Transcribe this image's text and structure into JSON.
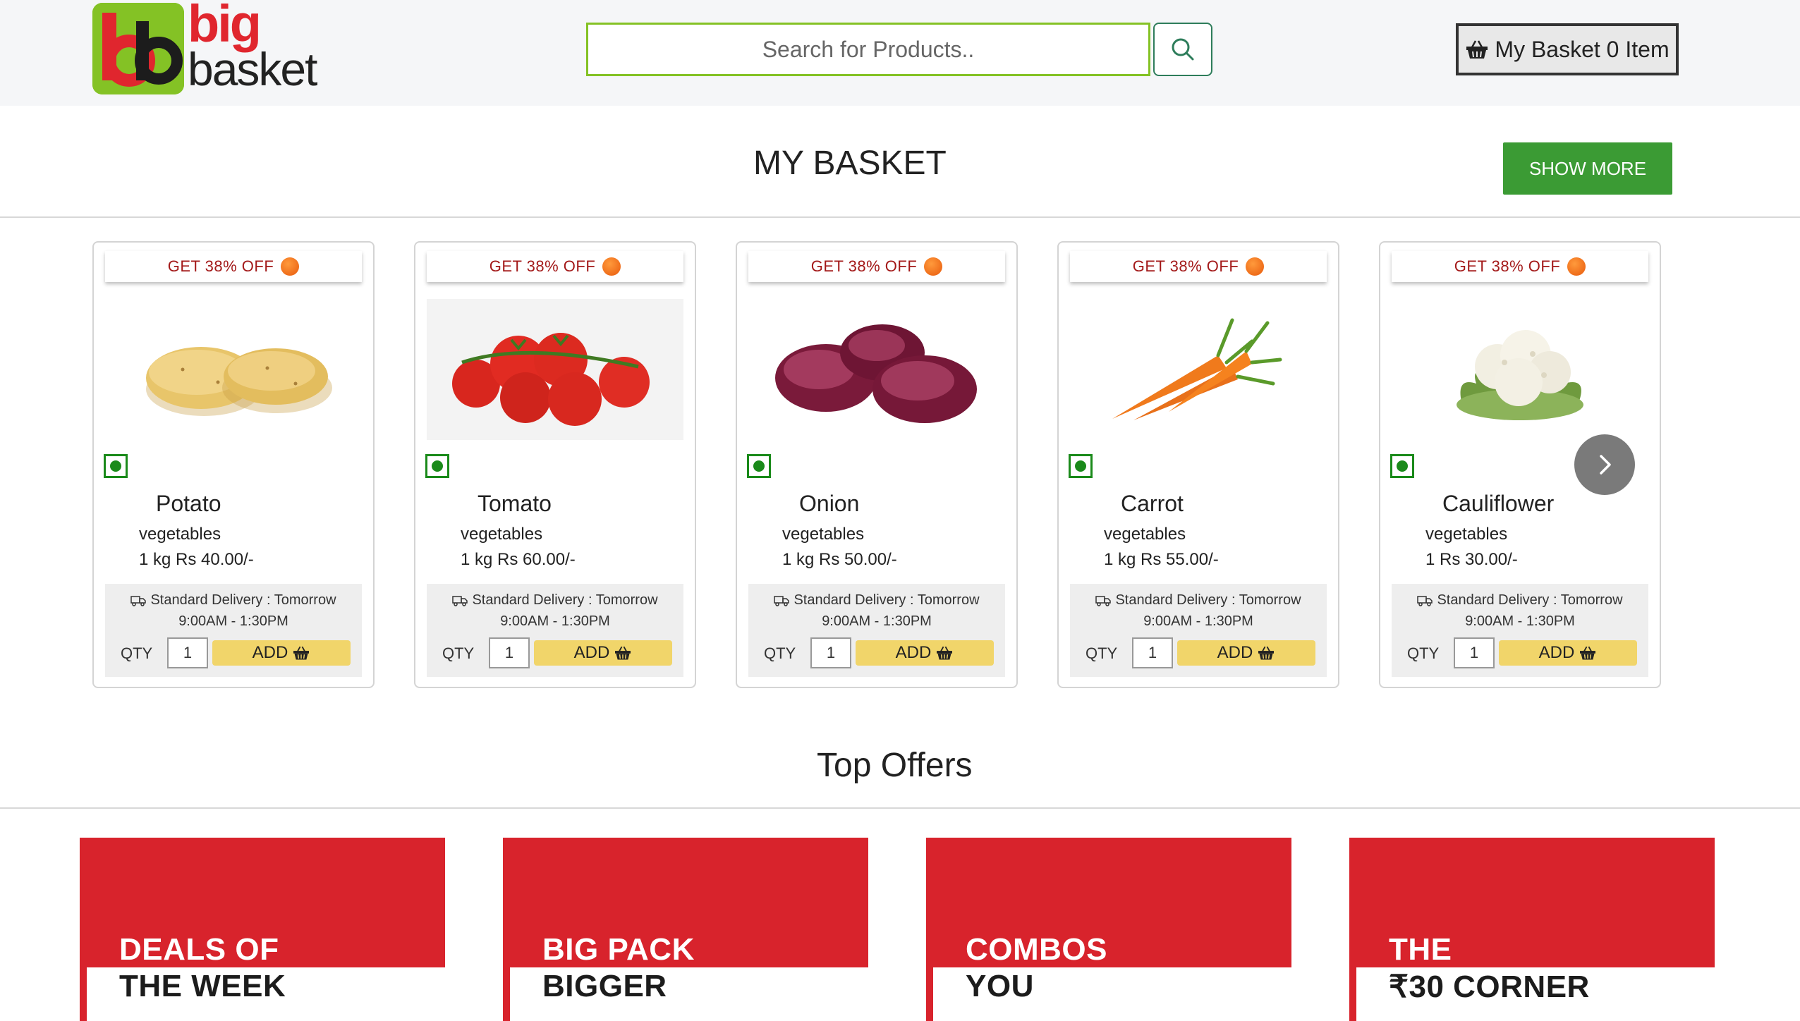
{
  "header": {
    "logo_line1": "big",
    "logo_line2": "basket",
    "search_placeholder": "Search for Products..",
    "basket_label": "My Basket 0 Item"
  },
  "colors": {
    "brand_green": "#84c225",
    "brand_red": "#e0262e",
    "show_more_green": "#3b9b34",
    "add_yellow": "#f1d56a",
    "offer_red": "#d8232c"
  },
  "my_basket": {
    "title": "MY BASKET",
    "show_more": "SHOW MORE"
  },
  "products": [
    {
      "offer": "GET 38% OFF",
      "name": "Potato",
      "category": "vegetables",
      "price": "1 kg Rs 40.00/-",
      "delivery": "Standard Delivery : Tomorrow",
      "slot": "9:00AM - 1:30PM",
      "qty_label": "QTY",
      "qty": "1",
      "add": "ADD",
      "icon": "potato-image"
    },
    {
      "offer": "GET 38% OFF",
      "name": "Tomato",
      "category": "vegetables",
      "price": "1 kg Rs 60.00/-",
      "delivery": "Standard Delivery : Tomorrow",
      "slot": "9:00AM - 1:30PM",
      "qty_label": "QTY",
      "qty": "1",
      "add": "ADD",
      "icon": "tomato-image"
    },
    {
      "offer": "GET 38% OFF",
      "name": "Onion",
      "category": "vegetables",
      "price": "1 kg Rs 50.00/-",
      "delivery": "Standard Delivery : Tomorrow",
      "slot": "9:00AM - 1:30PM",
      "qty_label": "QTY",
      "qty": "1",
      "add": "ADD",
      "icon": "onion-image"
    },
    {
      "offer": "GET 38% OFF",
      "name": "Carrot",
      "category": "vegetables",
      "price": "1 kg Rs 55.00/-",
      "delivery": "Standard Delivery : Tomorrow",
      "slot": "9:00AM - 1:30PM",
      "qty_label": "QTY",
      "qty": "1",
      "add": "ADD",
      "icon": "carrot-image"
    },
    {
      "offer": "GET 38% OFF",
      "name": "Cauliflower",
      "category": "vegetables",
      "price": "1 Rs 30.00/-",
      "delivery": "Standard Delivery : Tomorrow",
      "slot": "9:00AM - 1:30PM",
      "qty_label": "QTY",
      "qty": "1",
      "add": "ADD",
      "icon": "cauliflower-image"
    }
  ],
  "top_offers": {
    "title": "Top Offers",
    "tiles": [
      {
        "line1": "DEALS OF",
        "line2": "THE WEEK"
      },
      {
        "line1": "BIG PACK",
        "line2": "BIGGER"
      },
      {
        "line1": "COMBOS",
        "line2": "YOU"
      },
      {
        "line1": "THE",
        "line2": "₹30 CORNER"
      }
    ]
  }
}
